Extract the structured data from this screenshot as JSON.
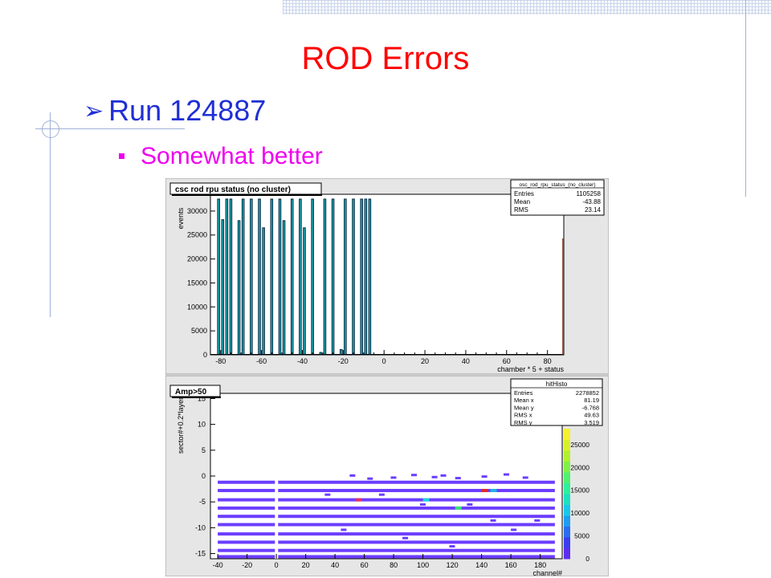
{
  "slide": {
    "title": "ROD Errors",
    "bullet1": "Run 124887",
    "bullet2": "Somewhat better",
    "accent_title": "#ff0000",
    "accent_bullet1": "#1f2fd6",
    "accent_bullet2": "#ee00ee",
    "bullet1_icon": "arrow-bullet-icon",
    "bullet2_icon": "square-bullet-icon"
  },
  "chart_data": [
    {
      "type": "bar",
      "title": "csc rod rpu status (no cluster)",
      "xlabel": "chamber * 5 + status",
      "ylabel": "events",
      "xlim": [
        -85,
        88
      ],
      "ylim": [
        0,
        33500
      ],
      "xticks": [
        -80,
        -60,
        -40,
        -20,
        0,
        20,
        40,
        60,
        80
      ],
      "yticks": [
        0,
        5000,
        10000,
        15000,
        20000,
        25000,
        30000
      ],
      "grid": false,
      "stats": {
        "name": "osc_rod_rpu_status_(no_cluster)",
        "rows": [
          [
            "Entries",
            "1105258"
          ],
          [
            "Mean",
            "-43.88"
          ],
          [
            "RMS",
            "23.14"
          ]
        ]
      },
      "x": [
        -81,
        -79,
        -77,
        -75,
        -71,
        -69,
        -65,
        -61,
        -59,
        -55,
        -51,
        -49,
        -45,
        -41,
        -39,
        -35,
        -31,
        -29,
        -25,
        -21,
        -19,
        -15,
        -11,
        -9,
        -7
      ],
      "values": [
        32500,
        28200,
        32500,
        32500,
        28000,
        32500,
        32500,
        32500,
        26500,
        32500,
        32500,
        28000,
        32500,
        32500,
        26500,
        32500,
        500,
        32500,
        32500,
        1100,
        32500,
        32500,
        32500,
        32500,
        32500
      ]
    },
    {
      "type": "heatmap",
      "title": "Amp>50",
      "xlabel": "channel#",
      "ylabel": "sector#+0.2*layer",
      "xlim": [
        -45,
        195
      ],
      "ylim": [
        -16,
        16
      ],
      "xticks": [
        -40,
        -20,
        0,
        20,
        40,
        60,
        80,
        100,
        120,
        140,
        160,
        180
      ],
      "yticks": [
        -15,
        -10,
        -5,
        0,
        5,
        10,
        15
      ],
      "colorbar_ticks": [
        0,
        5000,
        10000,
        15000,
        20000,
        25000
      ],
      "colorbar_partial_label": "00",
      "stats": {
        "name": "hitHisto",
        "rows": [
          [
            "Entries",
            "2278852"
          ],
          [
            "Mean x",
            "81.19"
          ],
          [
            "Mean y",
            "-6.768"
          ],
          [
            "RMS x",
            "49.63"
          ],
          [
            "RMS y",
            "3.519"
          ]
        ]
      },
      "bands_y": [
        -1.2,
        -2.8,
        -4.6,
        -6.2,
        -7.8,
        -9.4,
        -11.2,
        -12.8,
        -14.4,
        -15.6
      ],
      "band_x_range": [
        -40,
        190
      ]
    }
  ]
}
